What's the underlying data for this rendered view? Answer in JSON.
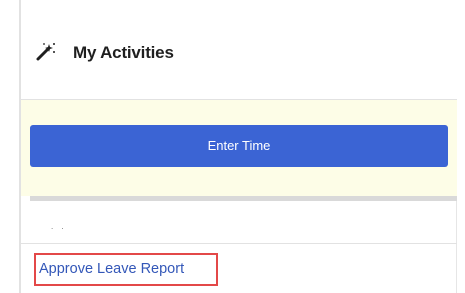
{
  "panel": {
    "title": "My Activities",
    "title_icon": "magic-wand-icon"
  },
  "actions": {
    "enter_time_label": "Enter Time"
  },
  "list": {
    "placeholder_dots": ". .",
    "approve_leave_report_label": "Approve Leave Report"
  },
  "colors": {
    "button_blue": "#3b64d4",
    "link_blue": "#3357b8",
    "highlight_red": "#e34848",
    "yellow_bg": "#fdfde7"
  }
}
